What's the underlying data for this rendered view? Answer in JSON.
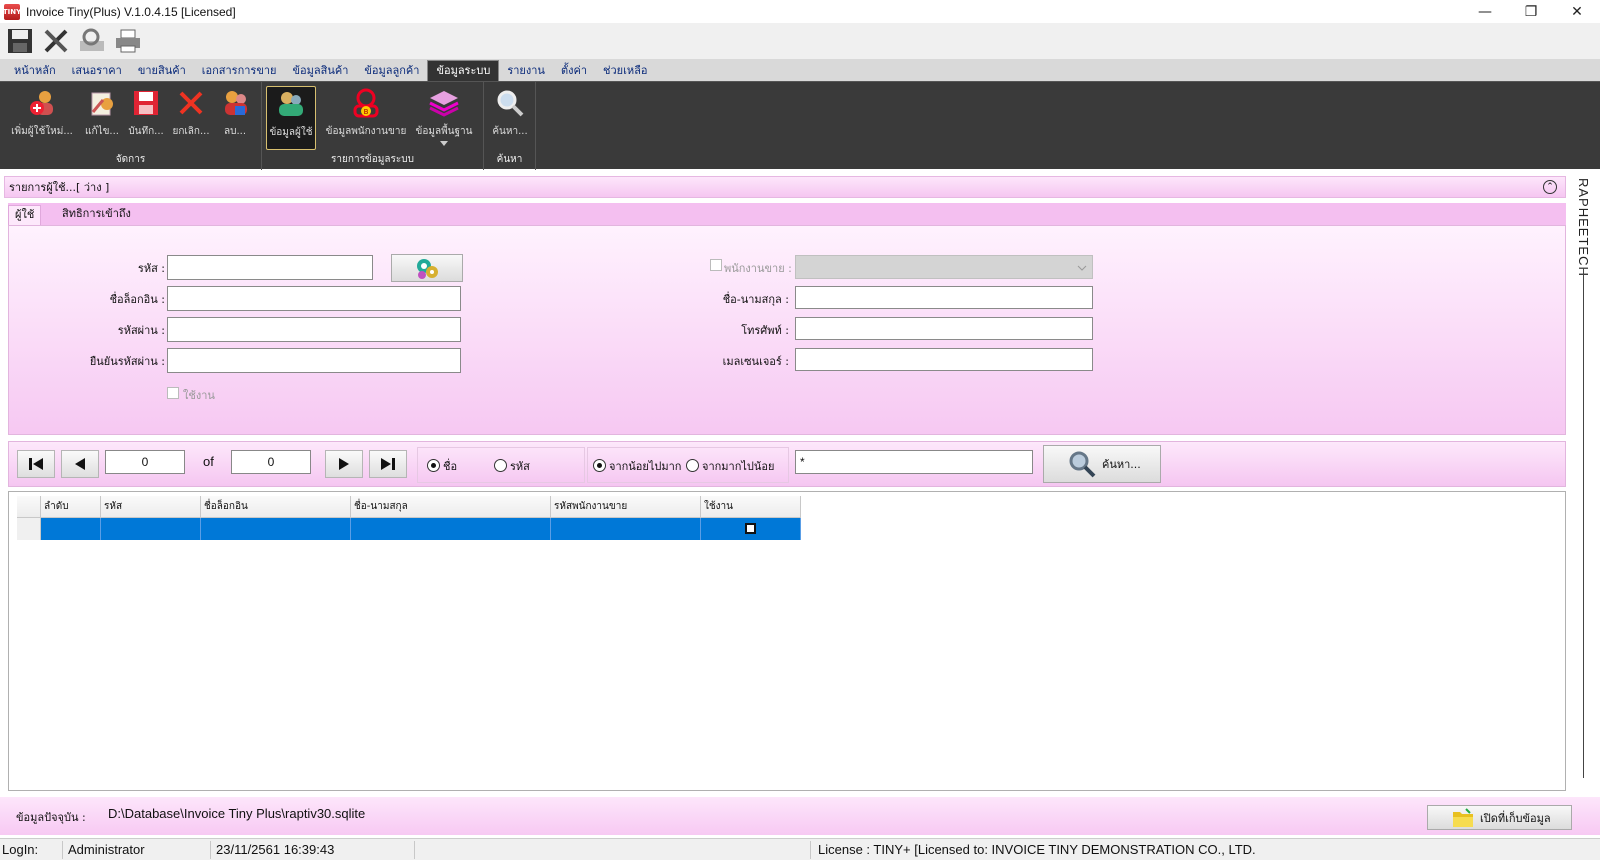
{
  "window": {
    "app_icon_text": "TINY",
    "title": "Invoice Tiny(Plus)  V.1.0.4.15 [Licensed]",
    "minimize": "—",
    "maximize": "❐",
    "close": "✕"
  },
  "quick_toolbar": {
    "icons": [
      "save-icon",
      "tools-icon",
      "print-preview-icon",
      "printer-icon"
    ]
  },
  "menu": {
    "tabs": [
      "หน้าหลัก",
      "เสนอราคา",
      "ขายสินค้า",
      "เอกสารการขาย",
      "ข้อมูลสินค้า",
      "ข้อมูลลูกค้า",
      "ข้อมูลระบบ",
      "รายงาน",
      "ตั้งค่า",
      "ช่วยเหลือ"
    ],
    "active_index": 6
  },
  "ribbon": {
    "group_manage": {
      "label": "จัดการ",
      "add": "เพิ่มผู้ใช้ใหม่...",
      "edit": "แก้ไข...",
      "save": "บันทึก...",
      "cancel": "ยกเลิก...",
      "delete": "ลบ..."
    },
    "group_system": {
      "label": "รายการข้อมูลระบบ",
      "users": "ข้อมูลผู้ใช้",
      "sales_staff": "ข้อมูลพนักงานขาย",
      "base_data": "ข้อมูลพื้นฐาน"
    },
    "group_search": {
      "label": "ค้นหา",
      "search": "ค้นหา..."
    }
  },
  "panel": {
    "title": "รายการผู้ใช้...[ ว่าง ]",
    "collapse_glyph": "⌃",
    "tabs": [
      "ผู้ใช้",
      "สิทธิการเข้าถึง"
    ]
  },
  "form": {
    "code_label": "รหัส :",
    "code_value": "",
    "login_label": "ชื่อล็อกอิน :",
    "login_value": "",
    "password_label": "รหัสผ่าน :",
    "password_value": "",
    "confirm_label": "ยืนยันรหัสผ่าน :",
    "confirm_value": "",
    "active_label": "ใช้งาน",
    "sales_label": "พนักงานขาย :",
    "fullname_label": "ชื่อ-นามสกุล :",
    "fullname_value": "",
    "phone_label": "โทรศัพท์ :",
    "phone_value": "",
    "email_label": "เมลเซนเจอร์ :",
    "email_value": ""
  },
  "navigator": {
    "current": "0",
    "of_label": "of",
    "total": "0",
    "sort_field_name": "ชื่อ",
    "sort_field_code": "รหัส",
    "sort_asc": "จากน้อยไปมาก",
    "sort_desc": "จากมากไปน้อย",
    "search_value": "*",
    "search_button": "ค้นหา..."
  },
  "grid": {
    "columns": [
      "ลำดับ",
      "รหัส",
      "ชื่อล็อกอิน",
      "ชื่อ-นามสกุล",
      "รหัสพนักงานขาย",
      "ใช้งาน"
    ]
  },
  "side_label": "RAPHEETECH",
  "database": {
    "label": "ข้อมูลปัจจุบัน :",
    "path": "D:\\Database\\Invoice Tiny Plus\\raptiv30.sqlite",
    "open_button": "เปิดที่เก็บข้อมูล"
  },
  "status": {
    "login_label": "LogIn:",
    "user": "Administrator",
    "datetime": "23/11/2561 16:39:43",
    "license": "License : TINY+ [Licensed to: INVOICE TINY DEMONSTRATION CO., LTD."
  },
  "colors": {
    "pink_panel": "#f5c6f1",
    "ribbon_bg": "#3a3a3a",
    "grid_selection": "#0078d7"
  }
}
